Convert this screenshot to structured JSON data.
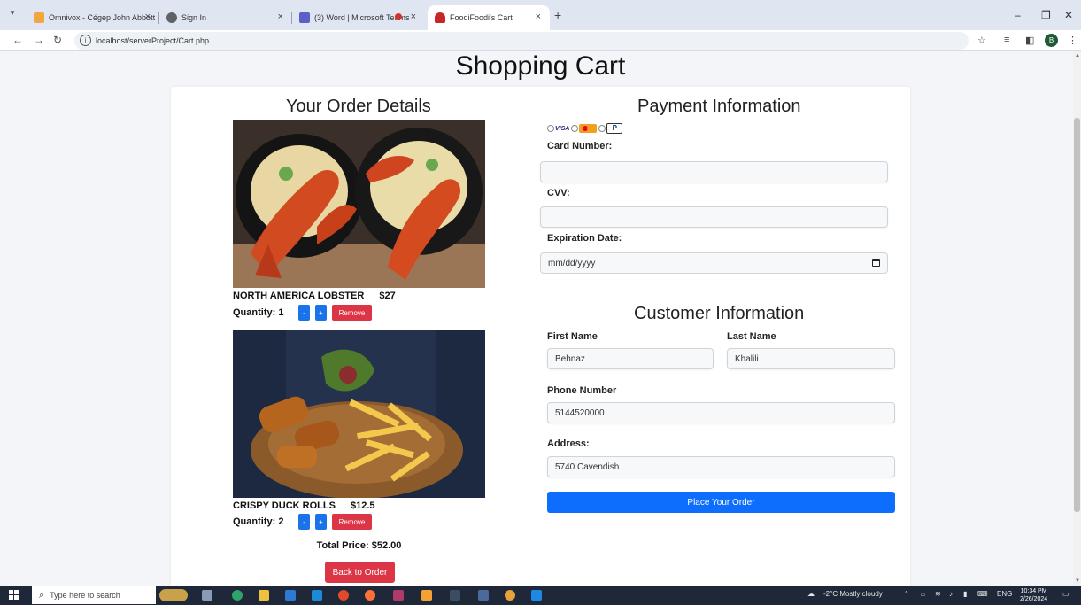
{
  "browser": {
    "tabs": [
      {
        "label": "Omnivox - Cégep John Abbott",
        "active": false
      },
      {
        "label": "Sign In",
        "active": false
      },
      {
        "label": "(3) Word | Microsoft Teams",
        "active": false
      },
      {
        "label": "FoodiFoodi's Cart",
        "active": true
      }
    ],
    "url": "localhost/serverProject/Cart.php",
    "profile_initial": "B"
  },
  "page": {
    "title": "Shopping Cart"
  },
  "order": {
    "heading": "Your Order Details",
    "items": [
      {
        "name": "NORTH AMERICA LOBSTER",
        "price": "$27",
        "quantity_label": "Quantity: 1",
        "minus": "-",
        "plus": "+",
        "remove": "Remove"
      },
      {
        "name": "CRISPY DUCK ROLLS",
        "price": "$12.5",
        "quantity_label": "Quantity: 2",
        "minus": "-",
        "plus": "+",
        "remove": "Remove"
      }
    ],
    "total": "Total Price: $52.00",
    "back_button": "Back to Order"
  },
  "payment": {
    "heading": "Payment Information",
    "methods": [
      "visa",
      "mastercard",
      "paypal"
    ],
    "visa_text": "VISA",
    "card_label": "Card Number:",
    "card_value": "",
    "cvv_label": "CVV:",
    "cvv_value": "",
    "exp_label": "Expiration Date:",
    "exp_placeholder": "mm/dd/yyyy"
  },
  "customer": {
    "heading": "Customer Information",
    "first_name_label": "First Name",
    "first_name_value": "Behnaz",
    "last_name_label": "Last Name",
    "last_name_value": "Khalili",
    "phone_label": "Phone Number",
    "phone_value": "5144520000",
    "address_label": "Address:",
    "address_value": "5740 Cavendish",
    "submit": "Place Your Order"
  },
  "taskbar": {
    "search_placeholder": "Type here to search",
    "weather": "-2°C  Mostly cloudy",
    "language": "ENG",
    "time": "10:34 PM",
    "date": "2/26/2024"
  },
  "colors": {
    "blue": "#1a73e8",
    "red": "#dc3545",
    "primary": "#0d6efd"
  }
}
